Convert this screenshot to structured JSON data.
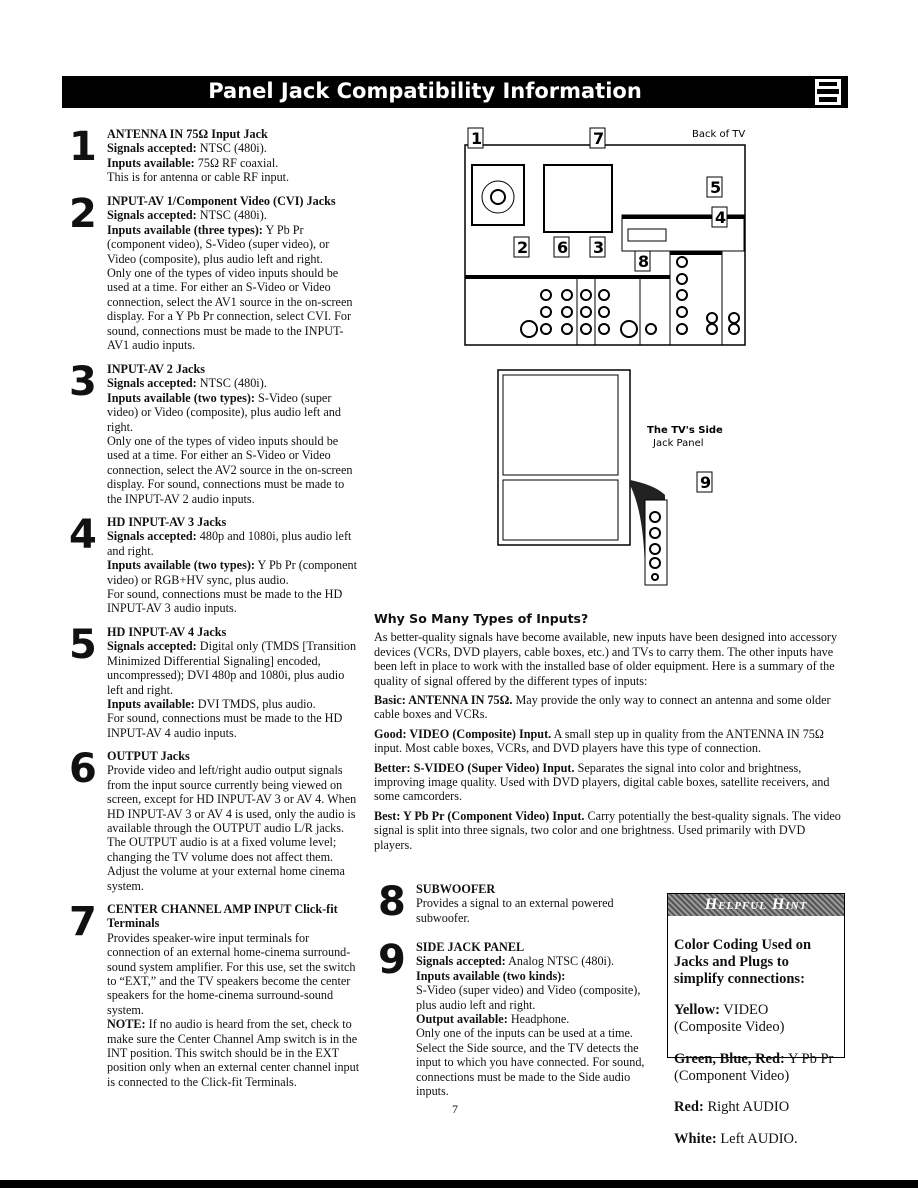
{
  "header": {
    "title": "Panel Jack Compatibility Information",
    "icon": "cable-plugs-icon"
  },
  "sections": [
    {
      "num": "1",
      "title": "ANTENNA IN 75Ω Input Jack",
      "paras": [
        [
          [
            "b",
            "Signals accepted:"
          ],
          [
            "t",
            " NTSC (480i)."
          ]
        ],
        [
          [
            "b",
            "Inputs available:"
          ],
          [
            "t",
            " 75Ω RF coaxial."
          ]
        ],
        [
          [
            "t",
            "This is for antenna or cable RF input."
          ]
        ]
      ]
    },
    {
      "num": "2",
      "title": "INPUT-AV 1/Component Video (CVI) Jacks",
      "paras": [
        [
          [
            "b",
            "Signals accepted:"
          ],
          [
            "t",
            " NTSC (480i)."
          ]
        ],
        [
          [
            "b",
            "Inputs available (three types):"
          ],
          [
            "t",
            " Y Pb Pr (component video), S-Video (super video), or Video (composite), plus audio left and right."
          ]
        ],
        [
          [
            "t",
            "Only one of the types of video inputs should be used at a time. For either an S-Video or Video connection, select the AV1 source in the on-screen display. For a Y Pb Pr connection, select CVI. For sound, connections must be made to the INPUT-AV1 audio inputs."
          ]
        ]
      ]
    },
    {
      "num": "3",
      "title": "INPUT-AV 2 Jacks",
      "paras": [
        [
          [
            "b",
            "Signals accepted:"
          ],
          [
            "t",
            " NTSC (480i)."
          ]
        ],
        [
          [
            "b",
            "Inputs available (two types):"
          ],
          [
            "t",
            " S-Video (super video) or Video (composite), plus audio left and right."
          ]
        ],
        [
          [
            "t",
            "Only one of the types of video inputs should be used at a time. For either an S-Video or Video connection, select the AV2 source in the on-screen display. For sound, connections must be made to the INPUT-AV 2 audio inputs."
          ]
        ]
      ]
    },
    {
      "num": "4",
      "title": "HD INPUT-AV 3 Jacks",
      "paras": [
        [
          [
            "b",
            "Signals accepted:"
          ],
          [
            "t",
            " 480p and 1080i, plus audio left and right."
          ]
        ],
        [
          [
            "b",
            "Inputs available (two types):"
          ],
          [
            "t",
            " Y Pb Pr (component video) or RGB+HV sync, plus audio."
          ]
        ],
        [
          [
            "t",
            "For sound, connections must be made to the HD INPUT-AV 3 audio inputs."
          ]
        ]
      ]
    },
    {
      "num": "5",
      "title": "HD INPUT-AV 4 Jacks",
      "paras": [
        [
          [
            "b",
            "Signals accepted:"
          ],
          [
            "t",
            " Digital only (TMDS [Transition Minimized Differential Signaling] encoded, uncompressed); DVI 480p and 1080i, plus audio left and right."
          ]
        ],
        [
          [
            "b",
            "Inputs available:"
          ],
          [
            "t",
            " DVI TMDS, plus audio."
          ]
        ],
        [
          [
            "t",
            "For sound, connections must be made to the HD INPUT-AV 4 audio inputs."
          ]
        ]
      ]
    },
    {
      "num": "6",
      "title": "OUTPUT Jacks",
      "paras": [
        [
          [
            "t",
            "Provide video and left/right audio output signals from the input source currently being viewed on screen, except for HD INPUT-AV 3 or AV 4. When HD INPUT-AV 3 or AV 4 is used, only the audio is available through the OUTPUT audio L/R jacks. The OUTPUT audio is at a fixed volume level; changing the TV volume does not affect them. Adjust the volume at your external home cinema system."
          ]
        ]
      ]
    },
    {
      "num": "7",
      "title": "CENTER CHANNEL AMP INPUT Click-fit Terminals",
      "paras": [
        [
          [
            "t",
            "Provides speaker-wire input terminals for connection of an external home-cinema surround-sound system amplifier. For this use, set the switch to “EXT,” and the TV speakers become the center speakers for the home-cinema surround-sound system."
          ]
        ],
        [
          [
            "b",
            "NOTE:"
          ],
          [
            "t",
            " If no audio is heard from the set, check to make sure the Center Channel Amp switch is in the INT position. This switch should be in the EXT position only when an external center channel input is connected to the Click-fit Terminals."
          ]
        ]
      ]
    },
    {
      "num": "8",
      "title": "SUBWOOFER",
      "paras": [
        [
          [
            "t",
            "Provides a signal to an external powered subwoofer."
          ]
        ]
      ]
    },
    {
      "num": "9",
      "title": "SIDE JACK PANEL",
      "paras": [
        [
          [
            "b",
            "Signals accepted:"
          ],
          [
            "t",
            " Analog NTSC (480i)."
          ]
        ],
        [
          [
            "b",
            "Inputs available (two kinds):"
          ]
        ],
        [
          [
            "t",
            "S-Video (super video) and Video (composite), plus audio left and right."
          ]
        ],
        [
          [
            "b",
            "Output available:"
          ],
          [
            "t",
            " Headphone."
          ]
        ],
        [
          [
            "t",
            "Only one of the inputs can be used at a time. Select the Side source, and the TV detects the input to which you have connected. For sound, connections must be made to the Side audio inputs."
          ]
        ]
      ]
    }
  ],
  "diagram": {
    "back_label": "Back of TV",
    "side_label_1": "The TV's Side",
    "side_label_2": "Jack Panel",
    "callouts": [
      "1",
      "7",
      "5",
      "4",
      "2",
      "6",
      "3",
      "8",
      "9"
    ]
  },
  "article": {
    "heading": "Why So Many Types of Inputs?",
    "paras": [
      [
        [
          "t",
          "As better-quality signals have become available, new inputs have been designed into accessory devices (VCRs, DVD players, cable boxes, etc.) and TVs to carry them. The other inputs have been left in place to work with the installed base of older equipment. Here is a summary of the quality of signal offered by the different types of inputs:"
        ]
      ],
      [
        [
          "b",
          "Basic: ANTENNA IN 75Ω."
        ],
        [
          "t",
          " May provide the only way to connect an antenna and some older cable boxes and VCRs."
        ]
      ],
      [
        [
          "b",
          "Good: VIDEO (Composite) Input."
        ],
        [
          "t",
          " A small step up in quality from the ANTENNA IN 75Ω input. Most cable boxes, VCRs, and DVD players have this type of connection."
        ]
      ],
      [
        [
          "b",
          "Better: S-VIDEO (Super Video) Input."
        ],
        [
          "t",
          " Separates the signal into color and brightness, improving image quality. Used with DVD players, digital cable boxes, satellite receivers, and some camcorders."
        ]
      ],
      [
        [
          "b",
          "Best: Y Pb Pr (Component Video) Input."
        ],
        [
          "t",
          " Carry potentially the best-quality signals. The video signal is split into three signals, two color and one brightness. Used primarily with DVD players."
        ]
      ]
    ]
  },
  "hint": {
    "heading": "Helpful Hint",
    "paras": [
      [
        [
          "b",
          "Color Coding Used on Jacks and Plugs to simplify connections:"
        ]
      ],
      [
        [
          "b",
          "Yellow:"
        ],
        [
          "t",
          " VIDEO (Composite Video)"
        ]
      ],
      [
        [
          "b",
          "Green, Blue, Red:"
        ],
        [
          "t",
          " Y Pb Pr (Component Video)"
        ]
      ],
      [
        [
          "b",
          "Red:"
        ],
        [
          "t",
          " Right AUDIO"
        ]
      ],
      [
        [
          "b",
          "White:"
        ],
        [
          "t",
          " Left AUDIO."
        ]
      ]
    ]
  },
  "page_number": "7"
}
